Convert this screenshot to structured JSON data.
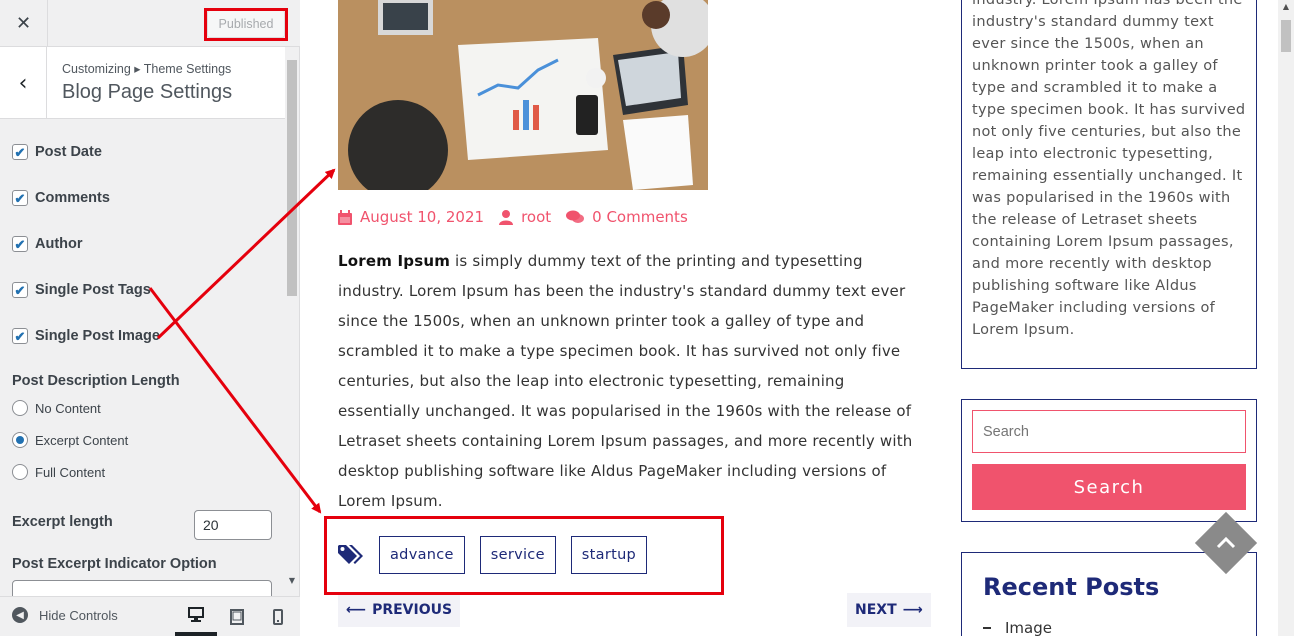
{
  "customizer": {
    "close_icon": "✕",
    "publish_label": "Published",
    "back_icon": "‹",
    "breadcrumb": "Customizing ▸ Theme Settings",
    "section_title": "Blog Page Settings",
    "checkboxes": [
      {
        "label": "Post Date",
        "checked": true
      },
      {
        "label": "Comments",
        "checked": true
      },
      {
        "label": "Author",
        "checked": true
      },
      {
        "label": "Single Post Tags",
        "checked": true
      },
      {
        "label": "Single Post Image",
        "checked": true
      }
    ],
    "description_length": {
      "label": "Post Description Length",
      "options": [
        "No Content",
        "Excerpt Content",
        "Full Content"
      ],
      "selected": "Excerpt Content"
    },
    "excerpt_length": {
      "label": "Excerpt length",
      "value": "20"
    },
    "excerpt_indicator": {
      "label": "Post Excerpt Indicator Option"
    },
    "footer": {
      "hide_controls_label": "Hide Controls",
      "devices": [
        "desktop-icon",
        "tablet-icon",
        "mobile-icon"
      ],
      "active_device": "desktop"
    }
  },
  "preview": {
    "meta": {
      "date": "August 10, 2021",
      "author": "root",
      "comments": "0 Comments"
    },
    "body": {
      "bold_lead": "Lorem Ipsum",
      "text": " is simply dummy text of the printing and typesetting industry. Lorem Ipsum has been the industry's standard dummy text ever since the 1500s, when an unknown printer took a galley of type and scrambled it to make a type specimen book. It has survived not only five centuries, but also the leap into electronic typesetting, remaining essentially unchanged. It was popularised in the 1960s with the release of Letraset sheets containing Lorem Ipsum passages, and more recently with desktop publishing software like Aldus PageMaker including versions of Lorem Ipsum."
    },
    "tags": [
      "advance",
      "service",
      "startup"
    ],
    "nav": {
      "previous": "PREVIOUS",
      "next": "NEXT"
    },
    "sidebar": {
      "about_text": "industry. Lorem Ipsum has been the industry's standard dummy text ever since the 1500s, when an unknown printer took a galley of type and scrambled it to make a type specimen book. It has survived not only five centuries, but also the leap into electronic typesetting, remaining essentially unchanged. It was popularised in the 1960s with the release of Letraset sheets containing Lorem Ipsum passages, and more recently with desktop publishing software like Aldus PageMaker including versions of Lorem Ipsum.",
      "search_placeholder": "Search",
      "search_button": "Search",
      "recent_posts_title": "Recent Posts",
      "recent_posts": [
        "Image"
      ]
    }
  },
  "colors": {
    "accent": "#f0536d",
    "navy": "#1e2a78",
    "annotation_red": "#e5000d",
    "wp_blue": "#2271b1"
  }
}
